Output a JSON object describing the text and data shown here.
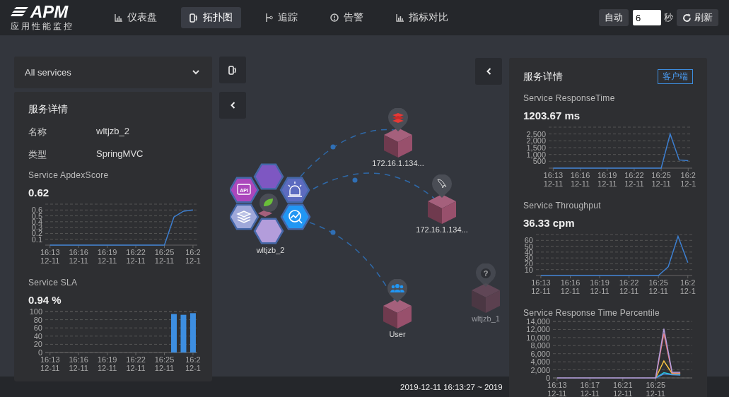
{
  "header": {
    "logo": {
      "title": "APM",
      "subtitle": "应用性能监控"
    },
    "tabs": [
      {
        "label": "仪表盘",
        "selected": false
      },
      {
        "label": "拓扑图",
        "selected": true
      },
      {
        "label": "追踪",
        "selected": false
      },
      {
        "label": "告警",
        "selected": false
      },
      {
        "label": "指标对比",
        "selected": false
      }
    ],
    "refresh": {
      "auto_label": "自动",
      "interval": "6",
      "unit": "秒",
      "refresh_label": "刷新"
    }
  },
  "service_select": {
    "value": "All services"
  },
  "left_panel": {
    "title": "服务详情",
    "fields": [
      {
        "label": "名称",
        "value": "wltjzb_2"
      },
      {
        "label": "类型",
        "value": "SpringMVC"
      }
    ],
    "metrics": [
      {
        "title": "Service ApdexScore",
        "value": "0.62",
        "chart_data": {
          "type": "line",
          "categories": [
            "16:13 12-11",
            null,
            null,
            "16:16 12-11",
            null,
            null,
            "16:19 12-11",
            null,
            null,
            "16:22 12-11",
            null,
            null,
            "16:25 12-11",
            null,
            null,
            "16:2 12-1"
          ],
          "series": [
            {
              "color": "#3d7fd0",
              "values": [
                0,
                0,
                0,
                0,
                0,
                0,
                0,
                0,
                0,
                0,
                0,
                0,
                0,
                0.48,
                0.58,
                0.6
              ]
            }
          ],
          "grid": true,
          "ylim": [
            0,
            0.7
          ],
          "yticks": [
            0.1,
            0.2,
            0.3,
            0.4,
            0.5,
            0.6
          ]
        }
      },
      {
        "title": "Service SLA",
        "value": "0.94 %",
        "chart_data": {
          "type": "bar",
          "categories": [
            "16:13 12-11",
            null,
            null,
            "16:16 12-11",
            null,
            null,
            "16:19 12-11",
            null,
            null,
            "16:22 12-11",
            null,
            null,
            "16:25 12-11",
            null,
            null,
            "16:2 12-1"
          ],
          "series": [
            {
              "color": "#3d8ee0",
              "values": [
                null,
                null,
                null,
                null,
                null,
                null,
                null,
                null,
                null,
                null,
                null,
                null,
                null,
                94,
                92,
                96
              ]
            }
          ],
          "grid": true,
          "ylim": [
            0,
            100
          ],
          "yticks": [
            0,
            20,
            40,
            60,
            80,
            100
          ]
        }
      }
    ]
  },
  "topology": {
    "service": {
      "label": "wltjzb_2",
      "api_label": "API"
    },
    "nodes": [
      {
        "label": "172.16.1.134...",
        "kind": "redis",
        "dimmed": false
      },
      {
        "label": "172.16.1.134...",
        "kind": "mysql",
        "dimmed": false
      },
      {
        "label": "User",
        "kind": "user",
        "dimmed": false
      },
      {
        "label": "wltjzb_1",
        "kind": "unknown",
        "badge": "?",
        "dimmed": true
      }
    ]
  },
  "right_panel": {
    "title": "服务详情",
    "client_button": "客户端",
    "metrics": [
      {
        "title": "Service ResponseTime",
        "value": "1203.67 ms",
        "chart_data": {
          "type": "line",
          "categories": [
            "16:13 12-11",
            null,
            null,
            "16:16 12-11",
            null,
            null,
            "16:19 12-11",
            null,
            null,
            "16:22 12-11",
            null,
            null,
            "16:25 12-11",
            null,
            null,
            "16:2 12-1"
          ],
          "series": [
            {
              "color": "#3d7fd0",
              "values": [
                0,
                0,
                0,
                0,
                0,
                0,
                0,
                0,
                0,
                0,
                0,
                0,
                0,
                2500,
                600,
                550
              ]
            }
          ],
          "grid": true,
          "ylim": [
            0,
            3000
          ],
          "yticks": [
            {
              "value": 500,
              "label": "500"
            },
            {
              "value": 1000,
              "label": "1,000"
            },
            {
              "value": 1500,
              "label": "1,500"
            },
            {
              "value": 2000,
              "label": "2,000"
            },
            {
              "value": 2500,
              "label": "2,500"
            }
          ]
        }
      },
      {
        "title": "Service Throughput",
        "value": "36.33 cpm",
        "chart_data": {
          "type": "line",
          "categories": [
            "16:13 12-11",
            null,
            null,
            "16:16 12-11",
            null,
            null,
            "16:19 12-11",
            null,
            null,
            "16:22 12-11",
            null,
            null,
            "16:25 12-11",
            null,
            null,
            "16:2 12-1"
          ],
          "series": [
            {
              "color": "#3d7fd0",
              "values": [
                0,
                0,
                0,
                0,
                0,
                0,
                0,
                0,
                0,
                0,
                0,
                0,
                0,
                15,
                67,
                22
              ]
            }
          ],
          "grid": true,
          "ylim": [
            0,
            70
          ],
          "yticks": [
            10,
            20,
            30,
            40,
            50,
            60
          ]
        }
      },
      {
        "title": "Service Response Time Percentile",
        "chart_data": {
          "type": "line",
          "categories": [
            "16:13 12-11",
            null,
            null,
            null,
            "16:17 12-11",
            null,
            null,
            null,
            "16:21 12-11",
            null,
            null,
            null,
            "16:25 12-11",
            null,
            null,
            null,
            null
          ],
          "series": [
            {
              "color": "#26c6da",
              "values": [
                null,
                null,
                null,
                null,
                null,
                null,
                null,
                null,
                null,
                null,
                null,
                null,
                0,
                1300,
                900,
                900,
                null
              ]
            },
            {
              "color": "#4a90e2",
              "values": [
                null,
                null,
                null,
                null,
                null,
                null,
                null,
                null,
                null,
                null,
                null,
                null,
                0,
                1000,
                800,
                700,
                null
              ]
            },
            {
              "color": "#f6c343",
              "values": [
                null,
                null,
                null,
                null,
                null,
                null,
                null,
                null,
                null,
                null,
                null,
                null,
                0,
                4200,
                1100,
                1100,
                null
              ]
            },
            {
              "color": "#e57373",
              "values": [
                null,
                null,
                null,
                null,
                null,
                null,
                null,
                null,
                null,
                null,
                null,
                null,
                0,
                11000,
                1200,
                1200,
                null
              ]
            },
            {
              "color": "#b39ddb",
              "values": [
                0,
                0,
                0,
                0,
                0,
                0,
                0,
                0,
                0,
                0,
                0,
                0,
                0,
                12200,
                1400,
                1400,
                null
              ]
            }
          ],
          "grid": true,
          "ylim": [
            0,
            14000
          ],
          "yticks": [
            {
              "value": 0,
              "label": "0"
            },
            {
              "value": 2000,
              "label": "2,000"
            },
            {
              "value": 4000,
              "label": "4,000"
            },
            {
              "value": 6000,
              "label": "6,000"
            },
            {
              "value": 8000,
              "label": "8,000"
            },
            {
              "value": 10000,
              "label": "10,000"
            },
            {
              "value": 12000,
              "label": "12,000"
            },
            {
              "value": 14000,
              "label": "14,000"
            }
          ]
        }
      }
    ]
  },
  "time_range": "2019-12-11 16:13:27 ~ 2019"
}
